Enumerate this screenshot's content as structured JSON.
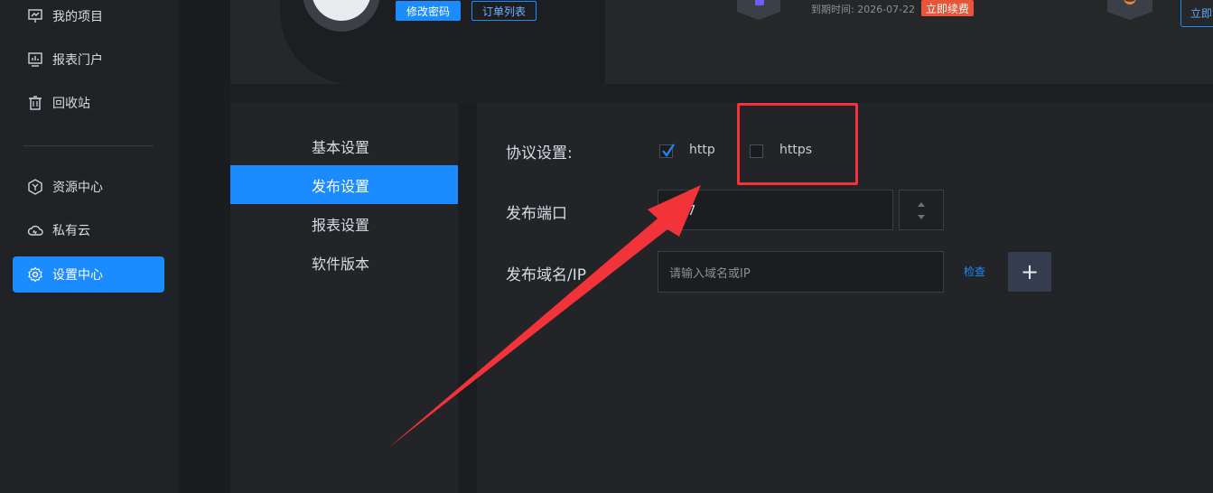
{
  "sidebar": {
    "items": [
      {
        "label": "我的项目",
        "icon": "presentation-chart-icon"
      },
      {
        "label": "报表门户",
        "icon": "monitor-chart-icon"
      },
      {
        "label": "回收站",
        "icon": "trash-icon"
      },
      {
        "label": "资源中心",
        "icon": "hex-y-icon"
      },
      {
        "label": "私有云",
        "icon": "cloud-icon"
      },
      {
        "label": "设置中心",
        "icon": "gear-icon",
        "active": true
      }
    ]
  },
  "header": {
    "change_password": "修改密码",
    "order_list": "订单列表",
    "expire_text": "到期时间: 2026-07-22",
    "renew": "立即续费",
    "right_button": "立即"
  },
  "subnav": {
    "items": [
      "基本设置",
      "发布设置",
      "报表设置",
      "软件版本"
    ],
    "active_index": 1
  },
  "form": {
    "protocol_label": "协议设置:",
    "http_label": "http",
    "http_checked": true,
    "https_label": "https",
    "https_checked": false,
    "port_label": "发布端口",
    "port_value": "7",
    "domain_label": "发布域名/IP",
    "domain_placeholder": "请输入域名或IP",
    "check_label": "检查",
    "add_label": "+"
  },
  "colors": {
    "accent": "#1a8cff",
    "annotation_red": "#f2333a",
    "renew": "#e8553a"
  }
}
